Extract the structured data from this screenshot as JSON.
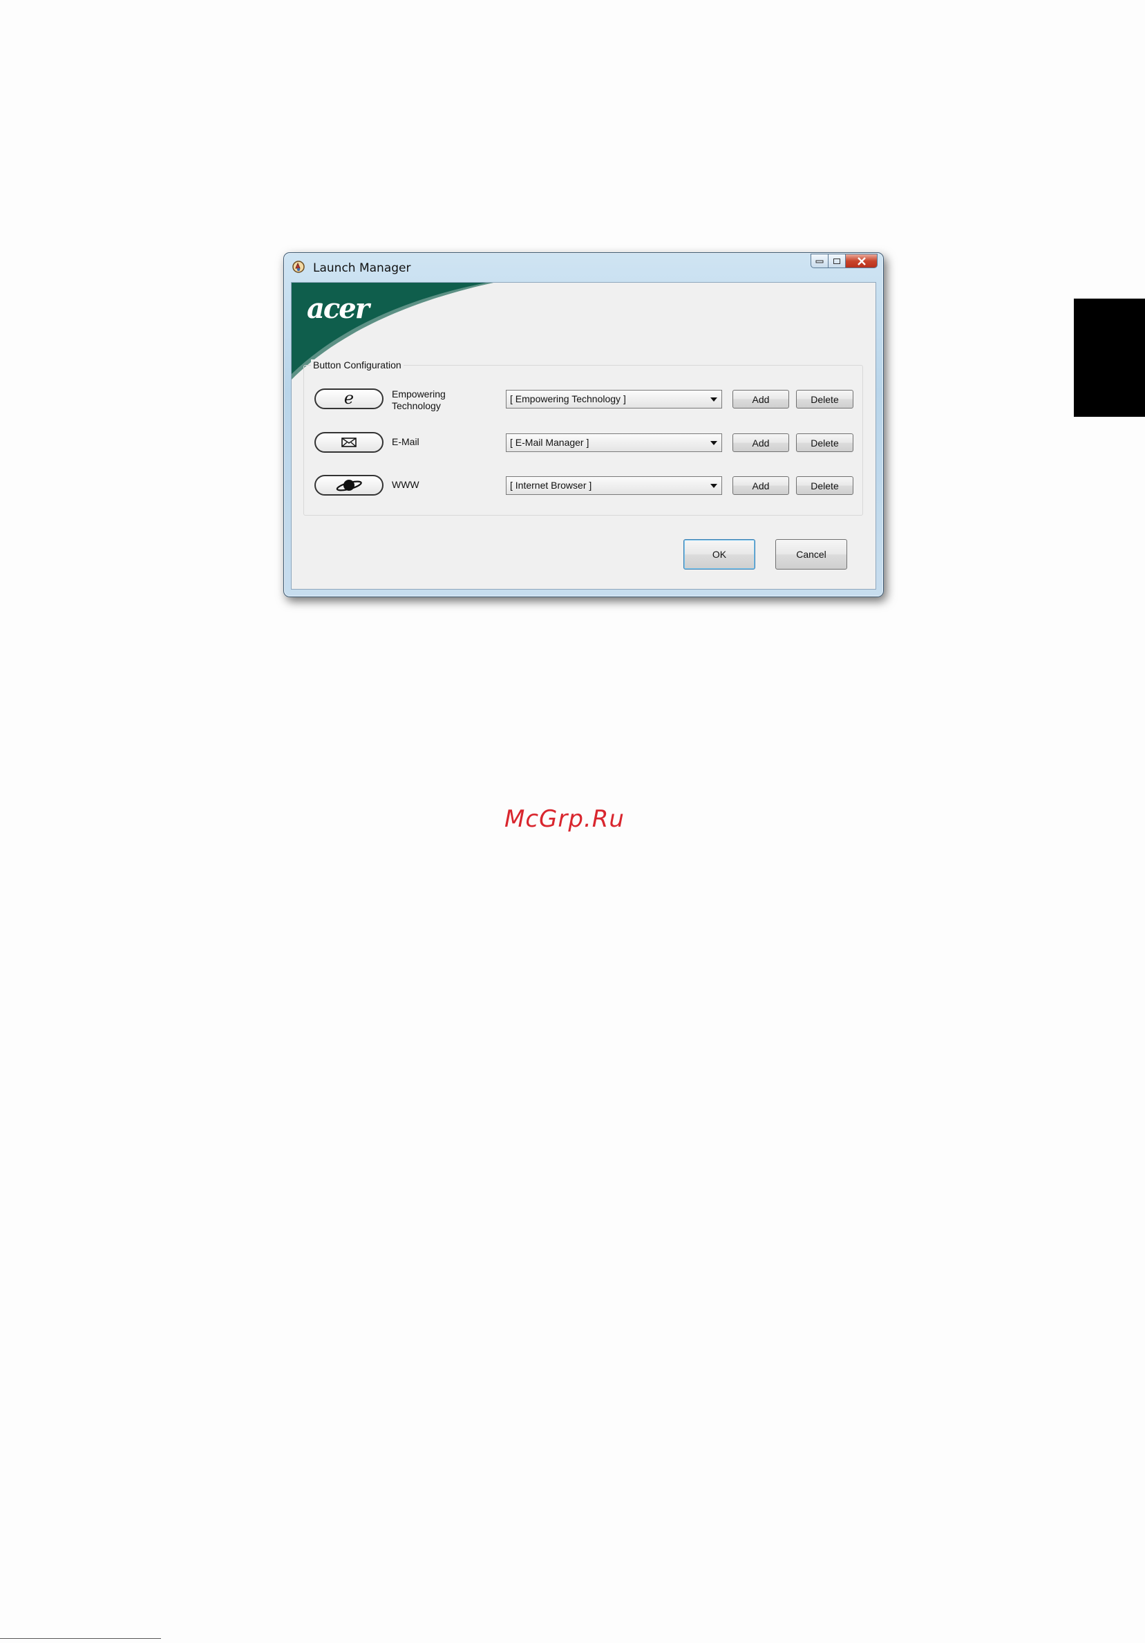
{
  "window": {
    "title": "Launch Manager",
    "logo_text": "acer",
    "accent_color": "#0f5e4c"
  },
  "group": {
    "title": "Button Configuration",
    "rows": [
      {
        "icon": "empowering-e-icon",
        "label_line1": "Empowering",
        "label_line2": "Technology",
        "selected": "[  Empowering Technology  ]",
        "add_label": "Add",
        "delete_label": "Delete"
      },
      {
        "icon": "envelope-icon",
        "label_line1": "E-Mail",
        "label_line2": "",
        "selected": "[  E-Mail Manager  ]",
        "add_label": "Add",
        "delete_label": "Delete"
      },
      {
        "icon": "planet-icon",
        "label_line1": "WWW",
        "label_line2": "",
        "selected": "[  Internet Browser  ]",
        "add_label": "Add",
        "delete_label": "Delete"
      }
    ]
  },
  "footer": {
    "ok_label": "OK",
    "cancel_label": "Cancel"
  },
  "watermark": "McGrp.Ru"
}
